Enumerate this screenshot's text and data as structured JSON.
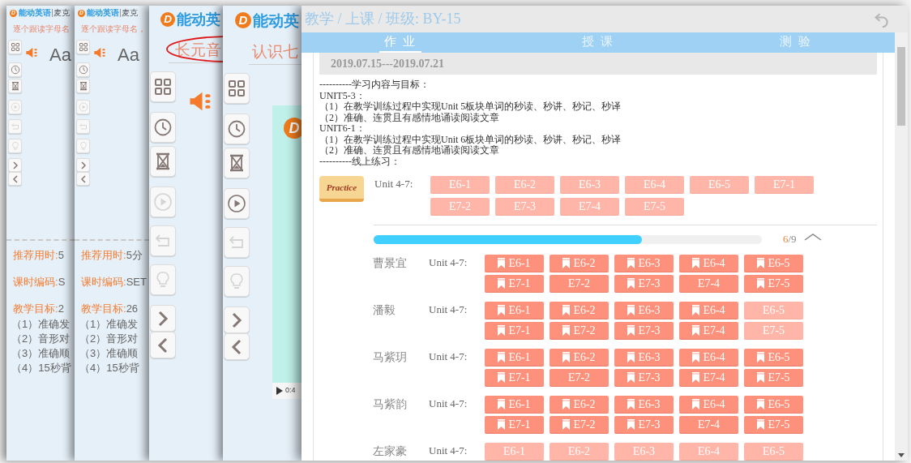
{
  "background_windows": [
    {
      "kind": "summary",
      "logo_mark": "D",
      "logo": "能动英语",
      "logo_sub": "麦克",
      "subtitle": "逐个跟读字母名",
      "letters": "Aa",
      "tools": [
        {
          "kind": "grid",
          "disabled": false
        },
        {
          "kind": "clock",
          "disabled": false
        },
        {
          "kind": "hourglass",
          "disabled": false
        },
        {
          "kind": "play",
          "disabled": true
        },
        {
          "kind": "back",
          "disabled": true
        },
        {
          "kind": "bulb",
          "disabled": true
        },
        {
          "kind": "next",
          "disabled": false
        },
        {
          "kind": "prev",
          "disabled": false
        }
      ],
      "info": [
        {
          "label": "推荐用时:",
          "value": "5"
        },
        {
          "label": "课时编码:",
          "value": "S"
        },
        {
          "label": "教学目标:",
          "value": "2"
        }
      ],
      "goals": [
        "（1）准确发",
        "（2）音形对",
        "（3）准确顺",
        "（4）15秒背"
      ]
    },
    {
      "kind": "summary",
      "logo_mark": "D",
      "logo": "能动英语",
      "logo_sub": "麦克",
      "subtitle": "逐个跟读字母名，",
      "letters": "Aa",
      "tools": [
        {
          "kind": "grid",
          "disabled": false
        },
        {
          "kind": "clock",
          "disabled": false
        },
        {
          "kind": "hourglass",
          "disabled": false
        },
        {
          "kind": "play",
          "disabled": true
        },
        {
          "kind": "back",
          "disabled": true
        },
        {
          "kind": "bulb",
          "disabled": true
        },
        {
          "kind": "next",
          "disabled": false
        },
        {
          "kind": "prev",
          "disabled": false
        }
      ],
      "info": [
        {
          "label": "推荐用时:",
          "value": "5分"
        },
        {
          "label": "课时编码:",
          "value": "SET"
        },
        {
          "label": "教学目标:",
          "value": "26"
        }
      ],
      "goals": [
        "（1）准确发",
        "（2）音形对",
        "（3）准确顺",
        "（4）15秒背"
      ]
    },
    {
      "kind": "lesson",
      "logo_mark": "D",
      "logo": "能动英",
      "title": "长元音",
      "circled": true,
      "tools": [
        {
          "kind": "grid",
          "disabled": false
        },
        {
          "kind": "clock",
          "disabled": false
        },
        {
          "kind": "hourglass",
          "disabled": false
        },
        {
          "kind": "play",
          "disabled": true
        },
        {
          "kind": "back",
          "disabled": true
        },
        {
          "kind": "bulb",
          "disabled": true
        },
        {
          "kind": "next",
          "disabled": false
        },
        {
          "kind": "prev",
          "disabled": false
        }
      ]
    },
    {
      "kind": "video",
      "logo_mark": "D",
      "logo": "能动英",
      "title": "认识七",
      "video_mark": "D",
      "video_time": "0:4",
      "tools": [
        {
          "kind": "grid",
          "disabled": false
        },
        {
          "kind": "clock",
          "disabled": false
        },
        {
          "kind": "hourglass",
          "disabled": false
        },
        {
          "kind": "play",
          "disabled": false
        },
        {
          "kind": "back",
          "disabled": true
        },
        {
          "kind": "bulb",
          "disabled": true
        },
        {
          "kind": "next",
          "disabled": false
        },
        {
          "kind": "prev",
          "disabled": false
        }
      ]
    }
  ],
  "front": {
    "breadcrumb": "教学 / 上课 / 班级: BY-15",
    "tabs": [
      {
        "label": "作 业",
        "selected": true
      },
      {
        "label": "授 课",
        "selected": false
      },
      {
        "label": "测 验",
        "selected": false
      }
    ],
    "week": "2019.07.15---2019.07.21",
    "notes": [
      "----------学习内容与目标：",
      "UNIT5-3：",
      "（1）在教学训练过程中实现Unit 5板块单词的秒读、秒讲、秒记、秒译",
      "（2）准确、连贯且有感情地诵读阅读文章",
      "UNIT6-1：",
      "（1）在教学训练过程中实现Unit 6板块单词的秒读、秒讲、秒记、秒译",
      "（2）准确、连贯且有感情地诵读阅读文章",
      "----------线上练习："
    ],
    "practice": {
      "badge": "Practice",
      "unit": "Unit 4-7:",
      "exercises": [
        {
          "label": "E6-1",
          "marked": false,
          "faded": true
        },
        {
          "label": "E6-2",
          "marked": false,
          "faded": true
        },
        {
          "label": "E6-3",
          "marked": false,
          "faded": true
        },
        {
          "label": "E6-4",
          "marked": false,
          "faded": true
        },
        {
          "label": "E6-5",
          "marked": false,
          "faded": true
        },
        {
          "label": "E7-1",
          "marked": false,
          "faded": true
        },
        {
          "label": "E7-2",
          "marked": false,
          "faded": true
        },
        {
          "label": "E7-3",
          "marked": false,
          "faded": true
        },
        {
          "label": "E7-4",
          "marked": false,
          "faded": true
        },
        {
          "label": "E7-5",
          "marked": false,
          "faded": true
        }
      ]
    },
    "progress": {
      "level": 0.69,
      "done": "6",
      "total": "/9"
    },
    "students": [
      {
        "name": "曹景宜",
        "unit": "Unit 4-7:",
        "exercises": [
          {
            "label": "E6-1",
            "marked": true,
            "faded": false
          },
          {
            "label": "E6-2",
            "marked": true,
            "faded": false
          },
          {
            "label": "E6-3",
            "marked": true,
            "faded": false
          },
          {
            "label": "E6-4",
            "marked": true,
            "faded": false
          },
          {
            "label": "E6-5",
            "marked": true,
            "faded": false
          },
          {
            "label": "E7-1",
            "marked": true,
            "faded": false
          },
          {
            "label": "E7-2",
            "marked": false,
            "faded": false
          },
          {
            "label": "E7-3",
            "marked": true,
            "faded": false
          },
          {
            "label": "E7-4",
            "marked": false,
            "faded": false
          },
          {
            "label": "E7-5",
            "marked": true,
            "faded": false
          }
        ]
      },
      {
        "name": "潘毅",
        "unit": "Unit 4-7:",
        "exercises": [
          {
            "label": "E6-1",
            "marked": true,
            "faded": false
          },
          {
            "label": "E6-2",
            "marked": true,
            "faded": false
          },
          {
            "label": "E6-3",
            "marked": true,
            "faded": false
          },
          {
            "label": "E6-4",
            "marked": true,
            "faded": false
          },
          {
            "label": "E6-5",
            "marked": false,
            "faded": true
          },
          {
            "label": "E7-1",
            "marked": true,
            "faded": false
          },
          {
            "label": "E7-2",
            "marked": true,
            "faded": false
          },
          {
            "label": "E7-3",
            "marked": true,
            "faded": false
          },
          {
            "label": "E7-4",
            "marked": true,
            "faded": false
          },
          {
            "label": "E7-5",
            "marked": false,
            "faded": true
          }
        ]
      },
      {
        "name": "马紫玥",
        "unit": "Unit 4-7:",
        "exercises": [
          {
            "label": "E6-1",
            "marked": true,
            "faded": false
          },
          {
            "label": "E6-2",
            "marked": true,
            "faded": false
          },
          {
            "label": "E6-3",
            "marked": true,
            "faded": false
          },
          {
            "label": "E6-4",
            "marked": true,
            "faded": false
          },
          {
            "label": "E6-5",
            "marked": true,
            "faded": false
          },
          {
            "label": "E7-1",
            "marked": true,
            "faded": false
          },
          {
            "label": "E7-2",
            "marked": false,
            "faded": false
          },
          {
            "label": "E7-3",
            "marked": true,
            "faded": false
          },
          {
            "label": "E7-4",
            "marked": true,
            "faded": false
          },
          {
            "label": "E7-5",
            "marked": true,
            "faded": false
          }
        ]
      },
      {
        "name": "马紫韵",
        "unit": "Unit 4-7:",
        "exercises": [
          {
            "label": "E6-1",
            "marked": true,
            "faded": false
          },
          {
            "label": "E6-2",
            "marked": true,
            "faded": false
          },
          {
            "label": "E6-3",
            "marked": true,
            "faded": false
          },
          {
            "label": "E6-4",
            "marked": true,
            "faded": false
          },
          {
            "label": "E6-5",
            "marked": true,
            "faded": false
          },
          {
            "label": "E7-1",
            "marked": true,
            "faded": false
          },
          {
            "label": "E7-2",
            "marked": true,
            "faded": false
          },
          {
            "label": "E7-3",
            "marked": true,
            "faded": false
          },
          {
            "label": "E7-4",
            "marked": false,
            "faded": false
          },
          {
            "label": "E7-5",
            "marked": true,
            "faded": false
          }
        ]
      },
      {
        "name": "左家豪",
        "unit": "Unit 4-7:",
        "exercises": [
          {
            "label": "E6-1",
            "marked": false,
            "faded": true
          },
          {
            "label": "E6-2",
            "marked": false,
            "faded": true
          },
          {
            "label": "E6-3",
            "marked": false,
            "faded": true
          },
          {
            "label": "E6-4",
            "marked": false,
            "faded": true
          },
          {
            "label": "E6-5",
            "marked": false,
            "faded": true
          }
        ]
      }
    ]
  }
}
